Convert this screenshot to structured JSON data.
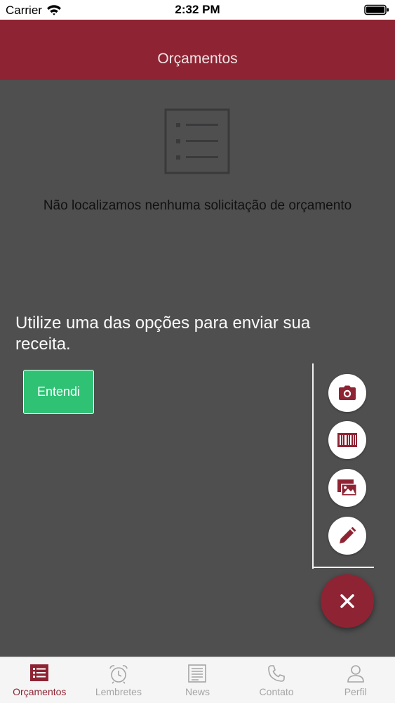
{
  "status_bar": {
    "carrier": "Carrier",
    "time": "2:32 PM"
  },
  "header": {
    "title": "Orçamentos"
  },
  "empty_state": {
    "icon": "list-icon",
    "message": "Não localizamos nenhuma solicitação de orçamento"
  },
  "hint": {
    "text": "Utilize uma das opções para enviar sua receita.",
    "button_label": "Entendi"
  },
  "fab": {
    "actions": [
      {
        "icon": "camera-icon"
      },
      {
        "icon": "barcode-icon"
      },
      {
        "icon": "gallery-icon"
      },
      {
        "icon": "pencil-icon"
      }
    ],
    "main_icon": "close-icon"
  },
  "tabs": [
    {
      "label": "Orçamentos",
      "icon": "list-icon",
      "active": true
    },
    {
      "label": "Lembretes",
      "icon": "alarm-clock-icon",
      "active": false
    },
    {
      "label": "News",
      "icon": "newspaper-icon",
      "active": false
    },
    {
      "label": "Contato",
      "icon": "phone-icon",
      "active": false
    },
    {
      "label": "Perfil",
      "icon": "user-icon",
      "active": false
    }
  ],
  "colors": {
    "brand": "#8e2433",
    "overlay": "#4f4f50",
    "confirm": "#2fc174"
  }
}
